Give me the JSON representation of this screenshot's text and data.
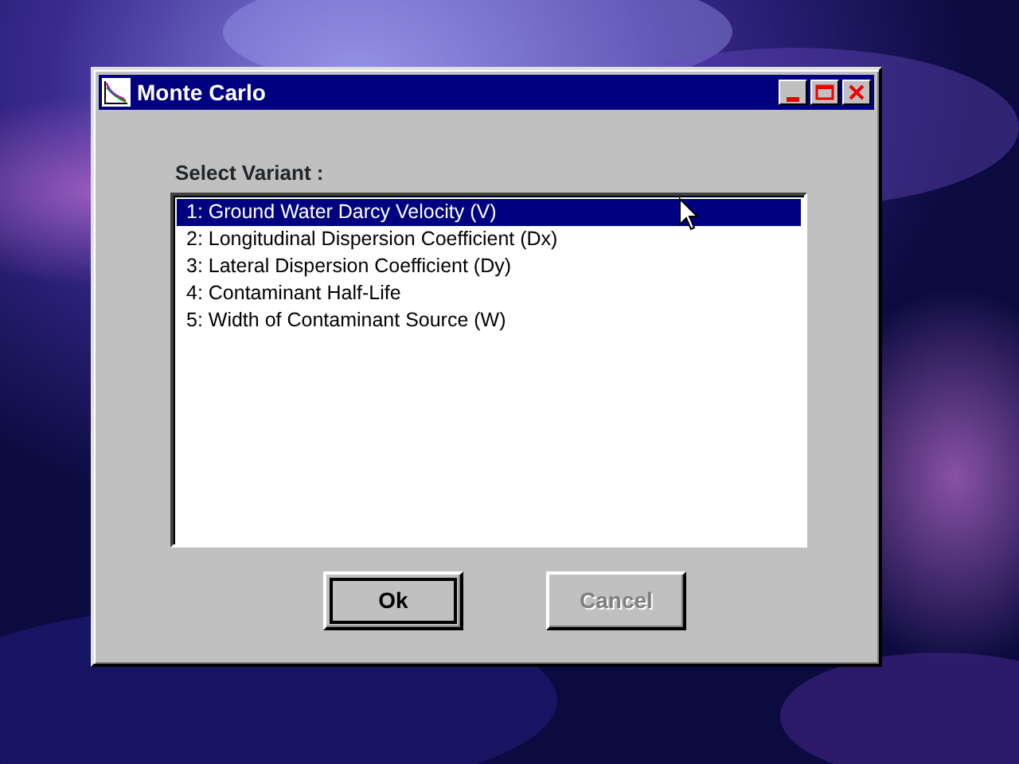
{
  "window": {
    "title": "Monte Carlo"
  },
  "list_label": "Select Variant :",
  "variants": [
    {
      "label": "1: Ground Water Darcy Velocity (V)",
      "selected": true
    },
    {
      "label": "2: Longitudinal Dispersion Coefficient (Dx)",
      "selected": false
    },
    {
      "label": "3: Lateral Dispersion Coefficient (Dy)",
      "selected": false
    },
    {
      "label": "4: Contaminant Half-Life",
      "selected": false
    },
    {
      "label": "5: Width of Contaminant Source (W)",
      "selected": false
    }
  ],
  "buttons": [
    {
      "label": "Ok",
      "disabled": false,
      "default": true
    },
    {
      "label": "Cancel",
      "disabled": true,
      "default": false
    }
  ]
}
